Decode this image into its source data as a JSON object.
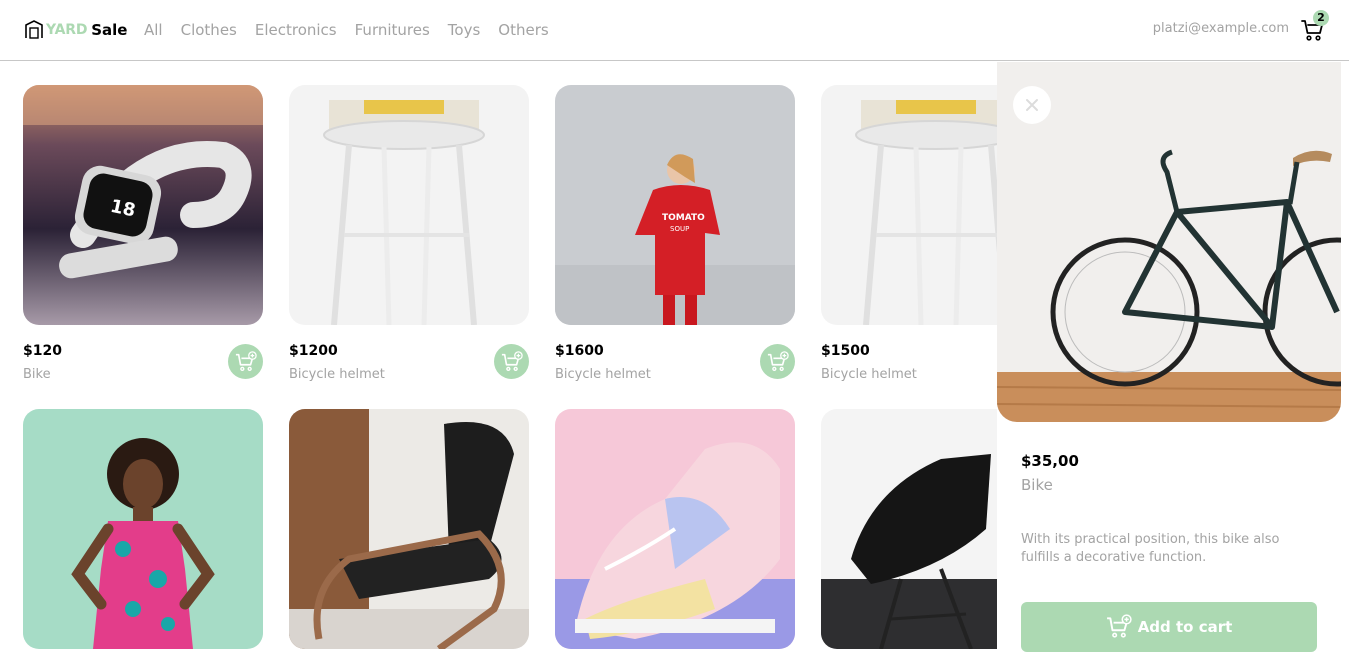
{
  "brand": {
    "yard": "YARD",
    "sale": "Sale"
  },
  "nav": {
    "menu": [
      "All",
      "Clothes",
      "Electronics",
      "Furnitures",
      "Toys",
      "Others"
    ],
    "email": "platzi@example.com",
    "cart_count": "2"
  },
  "products": [
    {
      "price": "$120",
      "name": "Bike",
      "image": "smartwatch"
    },
    {
      "price": "$1200",
      "name": "Bicycle helmet",
      "image": "white-stool"
    },
    {
      "price": "$1600",
      "name": "Bicycle helmet",
      "image": "red-sweater-woman"
    },
    {
      "price": "$1500",
      "name": "Bicycle helmet",
      "image": "white-stool"
    },
    {
      "price": "",
      "name": "",
      "image": "woman-colorful-dress"
    },
    {
      "price": "",
      "name": "",
      "image": "lounge-chair"
    },
    {
      "price": "",
      "name": "",
      "image": "pastel-sneakers"
    },
    {
      "price": "",
      "name": "",
      "image": "black-chair"
    }
  ],
  "detail": {
    "price": "$35,00",
    "name": "Bike",
    "description": "With its practical position, this bike also fulfills a decorative function.",
    "add_label": "Add to cart",
    "image": "bicycle"
  },
  "colors": {
    "accent": "#ACD9B2",
    "muted": "#A3A3A3",
    "border": "#C7C7C7"
  }
}
